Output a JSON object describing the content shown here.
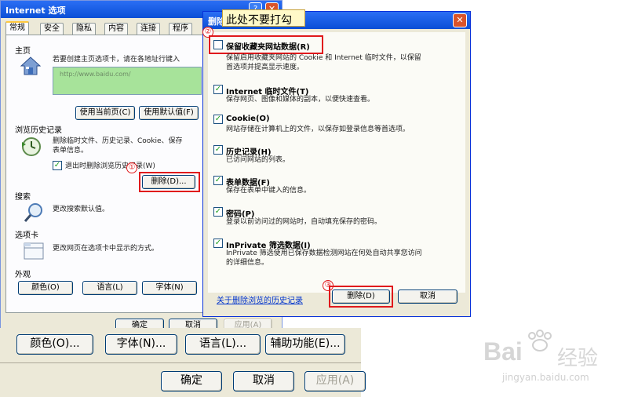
{
  "bg": {
    "title": "Internet 选项",
    "tabs": [
      "常规",
      "安全",
      "隐私",
      "内容",
      "连接",
      "程序"
    ],
    "homepage": {
      "section": "主页",
      "text": "若要创建主页选项卡，请在各地址行键入",
      "url": "http://www.baidu.com/",
      "btn_current": "使用当前页(C)",
      "btn_default": "使用默认值(F)"
    },
    "history": {
      "section": "浏览历史记录",
      "text1": "删除临时文件、历史记录、Cookie、保存",
      "text2": "表单信息。",
      "checkbox": "退出时删除浏览历史记录(W)",
      "delete_btn": "删除(D)..."
    },
    "search": {
      "section": "搜索",
      "text": "更改搜索默认值。"
    },
    "tabsec": {
      "section": "选项卡",
      "text": "更改网页在选项卡中显示的方式。"
    },
    "appearance": {
      "section": "外观",
      "btns": [
        "颜色(O)",
        "语言(L)",
        "字体(N)"
      ]
    },
    "footer": {
      "ok": "确定",
      "cancel": "取消",
      "apply": "应用(A)"
    },
    "outer_btns": [
      "颜色(O)...",
      "字体(N)...",
      "语言(L)...",
      "辅助功能(E)..."
    ],
    "outer_footer": {
      "ok": "确定",
      "cancel": "取消",
      "apply": "应用(A)"
    }
  },
  "dialog": {
    "title": "删除",
    "annotation": "此处不要打勾",
    "items": [
      {
        "label": "保留收藏夹网站数据(R)",
        "checked": false,
        "desc": [
          "保留启用收藏夹网站的 Cookie 和 Internet 临时文件，以保留",
          "首选项并提高显示速度。"
        ]
      },
      {
        "label": "Internet 临时文件(T)",
        "checked": true,
        "desc": [
          "保存网页、图像和媒体的副本，以便快速查看。"
        ]
      },
      {
        "label": "Cookie(O)",
        "checked": true,
        "desc": [
          "网站存储在计算机上的文件，以保存如登录信息等首选项。"
        ]
      },
      {
        "label": "历史记录(H)",
        "checked": true,
        "desc": [
          "已访问网站的列表。"
        ]
      },
      {
        "label": "表单数据(F)",
        "checked": true,
        "desc": [
          "保存在表单中键入的信息。"
        ]
      },
      {
        "label": "密码(P)",
        "checked": true,
        "desc": [
          "登录以前访问过的网站时，自动填充保存的密码。"
        ]
      },
      {
        "label": "InPrivate 筛选数据(I)",
        "checked": true,
        "desc": [
          "InPrivate 筛选使用已保存数据检测网站在何处自动共享您访问",
          "的详细信息。"
        ]
      }
    ],
    "about_link": "关于删除浏览的历史记录",
    "delete_btn": "删除(D)",
    "cancel_btn": "取消",
    "markers": [
      "①",
      "②",
      "③"
    ]
  },
  "watermark": {
    "brand": "Bai",
    "brand2": "经验",
    "url": "jingyan.baidu.com"
  },
  "colors": {
    "accent_red": "#e0191c",
    "xp_blue": "#0a4fd6",
    "annotation_bg": "#fff9c8"
  }
}
